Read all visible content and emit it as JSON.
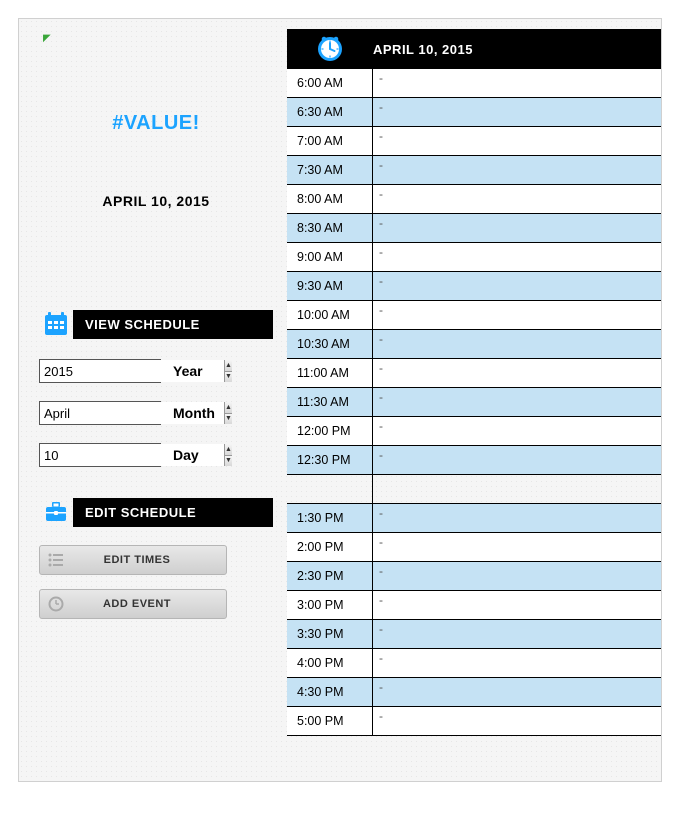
{
  "left": {
    "cell_mark": "◤",
    "value_error": "#VALUE!",
    "date_text": "APRIL 10, 2015",
    "view_header": "VIEW SCHEDULE",
    "edit_header": "EDIT SCHEDULE",
    "fields": {
      "year": {
        "value": "2015",
        "label": "Year"
      },
      "month": {
        "value": "April",
        "label": "Month"
      },
      "day": {
        "value": "10",
        "label": "Day"
      }
    },
    "edit_times_label": "EDIT TIMES",
    "add_event_label": "ADD EVENT"
  },
  "schedule": {
    "date_header": "APRIL 10, 2015",
    "rows": [
      {
        "time": "6:00 AM",
        "event": "-",
        "alt": false
      },
      {
        "time": "6:30 AM",
        "event": "-",
        "alt": true
      },
      {
        "time": "7:00 AM",
        "event": "-",
        "alt": false
      },
      {
        "time": "7:30 AM",
        "event": "-",
        "alt": true
      },
      {
        "time": "8:00 AM",
        "event": "-",
        "alt": false
      },
      {
        "time": "8:30 AM",
        "event": "-",
        "alt": true
      },
      {
        "time": "9:00 AM",
        "event": "-",
        "alt": false
      },
      {
        "time": "9:30 AM",
        "event": "-",
        "alt": true
      },
      {
        "time": "10:00 AM",
        "event": "-",
        "alt": false
      },
      {
        "time": "10:30 AM",
        "event": "-",
        "alt": true
      },
      {
        "time": "11:00 AM",
        "event": "-",
        "alt": false
      },
      {
        "time": "11:30 AM",
        "event": "-",
        "alt": true
      },
      {
        "time": "12:00 PM",
        "event": "-",
        "alt": false
      },
      {
        "time": "12:30 PM",
        "event": "-",
        "alt": true
      },
      {
        "time": "",
        "event": "",
        "gap": true
      },
      {
        "time": "1:30 PM",
        "event": "-",
        "alt": true
      },
      {
        "time": "2:00 PM",
        "event": "-",
        "alt": false
      },
      {
        "time": "2:30 PM",
        "event": "-",
        "alt": true
      },
      {
        "time": "3:00 PM",
        "event": "-",
        "alt": false
      },
      {
        "time": "3:30 PM",
        "event": "-",
        "alt": true
      },
      {
        "time": "4:00 PM",
        "event": "-",
        "alt": false
      },
      {
        "time": "4:30 PM",
        "event": "-",
        "alt": true
      },
      {
        "time": "5:00 PM",
        "event": "-",
        "alt": false
      }
    ]
  }
}
